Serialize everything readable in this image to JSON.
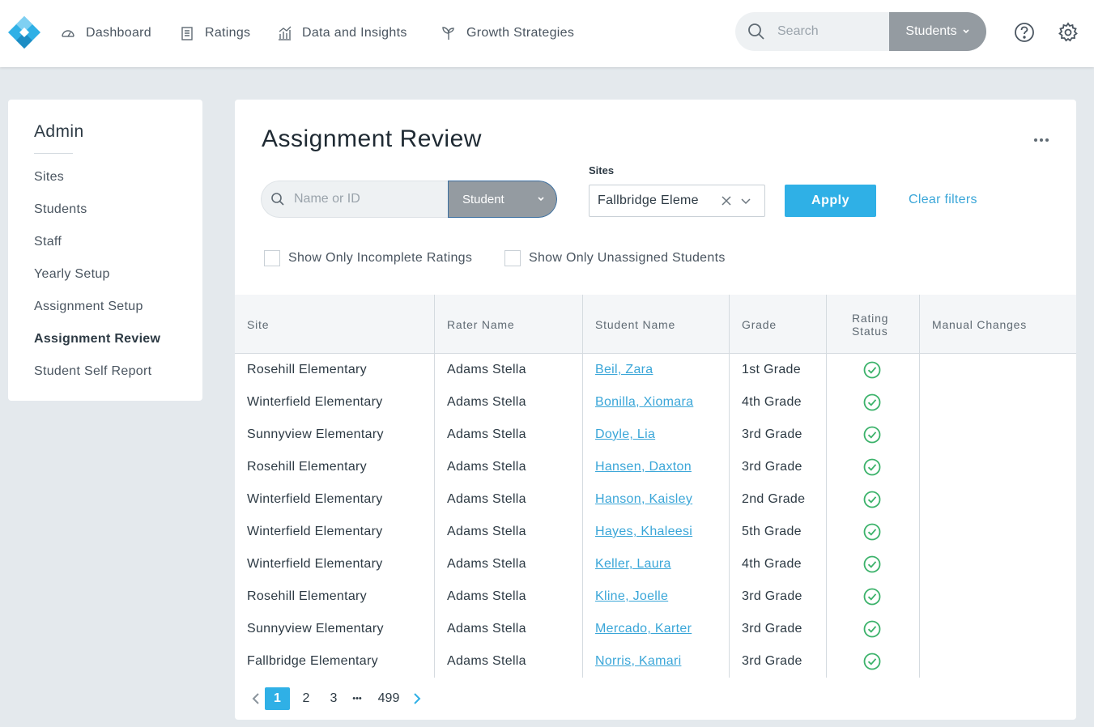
{
  "topnav": {
    "items": [
      {
        "label": "Dashboard",
        "icon": "gauge-icon"
      },
      {
        "label": "Ratings",
        "icon": "clipboard-icon"
      },
      {
        "label": "Data and Insights",
        "icon": "bar-chart-icon"
      },
      {
        "label": "Growth Strategies",
        "icon": "sprout-icon"
      }
    ],
    "search_placeholder": "Search",
    "search_scope": "Students",
    "accent_color": "#2fb0e6"
  },
  "sidebar": {
    "title": "Admin",
    "items": [
      {
        "label": "Sites"
      },
      {
        "label": "Students"
      },
      {
        "label": "Staff"
      },
      {
        "label": "Yearly Setup"
      },
      {
        "label": "Assignment Setup"
      },
      {
        "label": "Assignment Review",
        "active": true
      },
      {
        "label": "Student Self Report"
      }
    ]
  },
  "main": {
    "title": "Assignment Review",
    "filter_search_placeholder": "Name or ID",
    "filter_search_type": "Student",
    "sites_label": "Sites",
    "sites_value": "Fallbridge Eleme",
    "apply_label": "Apply",
    "clear_label": "Clear filters",
    "checkbox_incomplete": "Show Only Incomplete Ratings",
    "checkbox_unassigned": "Show Only Unassigned Students"
  },
  "table": {
    "headers": [
      "Site",
      "Rater Name",
      "Student Name",
      "Grade",
      "Rating Status",
      "Manual Changes"
    ],
    "rows": [
      {
        "site": "Rosehill Elementary",
        "rater": "Adams Stella",
        "student": "Beil, Zara",
        "grade": "1st Grade",
        "status": "complete",
        "manual": ""
      },
      {
        "site": "Winterfield Elementary",
        "rater": "Adams Stella",
        "student": "Bonilla, Xiomara",
        "grade": "4th Grade",
        "status": "complete",
        "manual": ""
      },
      {
        "site": "Sunnyview Elementary",
        "rater": "Adams Stella",
        "student": "Doyle, Lia",
        "grade": "3rd Grade",
        "status": "complete",
        "manual": ""
      },
      {
        "site": "Rosehill Elementary",
        "rater": "Adams Stella",
        "student": "Hansen, Daxton",
        "grade": "3rd Grade",
        "status": "complete",
        "manual": ""
      },
      {
        "site": "Winterfield Elementary",
        "rater": "Adams Stella",
        "student": "Hanson, Kaisley",
        "grade": "2nd Grade",
        "status": "complete",
        "manual": ""
      },
      {
        "site": "Winterfield Elementary",
        "rater": "Adams Stella",
        "student": "Hayes, Khaleesi",
        "grade": "5th Grade",
        "status": "complete",
        "manual": ""
      },
      {
        "site": "Winterfield Elementary",
        "rater": "Adams Stella",
        "student": "Keller, Laura",
        "grade": "4th Grade",
        "status": "complete",
        "manual": ""
      },
      {
        "site": "Rosehill Elementary",
        "rater": "Adams Stella",
        "student": "Kline, Joelle",
        "grade": "3rd Grade",
        "status": "complete",
        "manual": ""
      },
      {
        "site": "Sunnyview Elementary",
        "rater": "Adams Stella",
        "student": "Mercado, Karter",
        "grade": "3rd Grade",
        "status": "complete",
        "manual": ""
      },
      {
        "site": "Fallbridge Elementary",
        "rater": "Adams Stella",
        "student": "Norris, Kamari",
        "grade": "3rd Grade",
        "status": "complete",
        "manual": ""
      }
    ],
    "status_color": "#3bb26a"
  },
  "pagination": {
    "pages": [
      "1",
      "2",
      "3"
    ],
    "ellipsis": "•••",
    "last_page": "499",
    "current": "1"
  }
}
